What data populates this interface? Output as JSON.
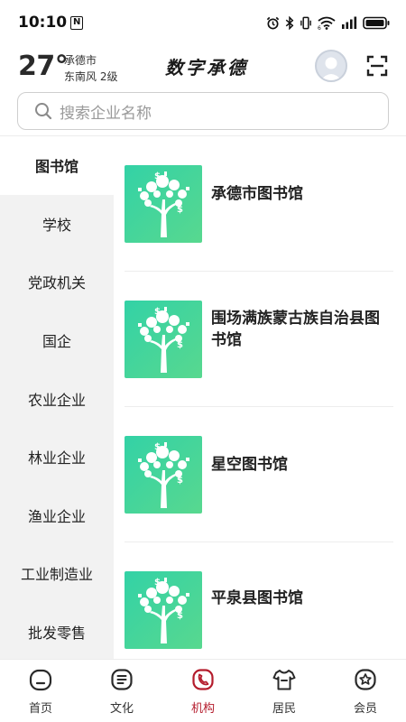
{
  "status_bar": {
    "time": "10:10",
    "nfc": "N",
    "icons": [
      "alarm-icon",
      "bluetooth-icon",
      "vibrate-icon",
      "wifi-icon",
      "signal-icon",
      "battery-icon"
    ]
  },
  "header": {
    "temperature": "27°",
    "city": "承德市",
    "wind": "东南风  2级",
    "brand": "数字承德"
  },
  "search": {
    "placeholder": "搜索企业名称"
  },
  "sidebar": {
    "items": [
      {
        "label": "图书馆",
        "active": true
      },
      {
        "label": "学校",
        "active": false
      },
      {
        "label": "党政机关",
        "active": false
      },
      {
        "label": "国企",
        "active": false
      },
      {
        "label": "农业企业",
        "active": false
      },
      {
        "label": "林业企业",
        "active": false
      },
      {
        "label": "渔业企业",
        "active": false
      },
      {
        "label": "工业制造业",
        "active": false
      },
      {
        "label": "批发零售",
        "active": false
      }
    ]
  },
  "list": {
    "items": [
      {
        "title": "承德市图书馆"
      },
      {
        "title": "围场满族蒙古族自治县图书馆"
      },
      {
        "title": "星空图书馆"
      },
      {
        "title": "平泉县图书馆"
      }
    ]
  },
  "bottom_nav": {
    "items": [
      {
        "label": "首页",
        "icon": "home-icon",
        "active": false
      },
      {
        "label": "文化",
        "icon": "culture-icon",
        "active": false
      },
      {
        "label": "机构",
        "icon": "institution-icon",
        "active": true
      },
      {
        "label": "居民",
        "icon": "resident-icon",
        "active": false
      },
      {
        "label": "会员",
        "icon": "member-icon",
        "active": false
      }
    ]
  },
  "colors": {
    "accent": "#b41c2c",
    "thumb_start": "#33d2a6",
    "thumb_end": "#58d88f",
    "sidebar_bg": "#f2f2f2"
  }
}
